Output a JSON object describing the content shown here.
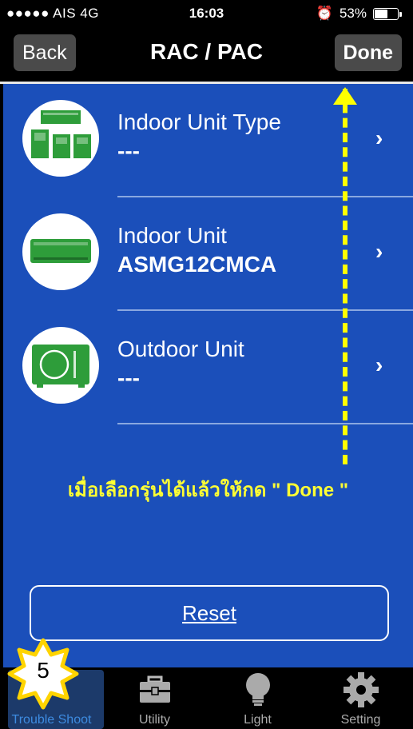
{
  "status_bar": {
    "carrier": "●●●●● AIS  4G",
    "time": "16:03",
    "alarm": "⏰",
    "battery_text": "53%",
    "battery_level": 0.53
  },
  "nav": {
    "back_label": "Back",
    "title": "RAC / PAC",
    "done_label": "Done"
  },
  "list": {
    "items": [
      {
        "title": "Indoor Unit Type",
        "value": "---",
        "icon": "indoor-unit-type-icon"
      },
      {
        "title": "Indoor Unit",
        "value": "ASMG12CMCA",
        "icon": "indoor-unit-icon"
      },
      {
        "title": "Outdoor Unit",
        "value": "---",
        "icon": "outdoor-unit-icon"
      }
    ],
    "chevron": "›"
  },
  "instruction": "เมื่อเลือกรุ่นได้แล้วให้กด \" Done \"",
  "reset_label": "Reset",
  "tabs": [
    {
      "label": "Trouble Shoot",
      "icon": "trouble-shoot-icon",
      "active": true
    },
    {
      "label": "Utility",
      "icon": "toolbox-icon",
      "active": false
    },
    {
      "label": "Light",
      "icon": "lightbulb-icon",
      "active": false
    },
    {
      "label": "Setting",
      "icon": "gear-icon",
      "active": false
    }
  ],
  "step_badge": "5",
  "colors": {
    "background_blue": "#1b4fba",
    "icon_green": "#2e9d3a",
    "annotation_yellow": "#ffff00",
    "tab_active": "#3d8be0"
  }
}
